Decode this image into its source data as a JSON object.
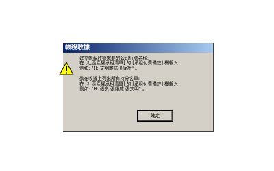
{
  "dialog": {
    "title": "帳稅收據",
    "icon": "warning-icon",
    "message_lines_1": [
      "建立帳稅收據需要的公司行號名稱:",
      "在 [社區產權承租清單] 的 [承租付費備註] 欄輸入",
      "例如: \"H: 文明雜誌出版社\" 。"
    ],
    "message_lines_2": [
      "欲在收據上列出所有持分名單:",
      "在 [社區產權承租清單] 的 [承租付費備註] 欄輸入",
      "例如: \"H: 張良 張耀威 張文明\" 。"
    ],
    "ok_label": "確定"
  },
  "colors": {
    "dialog_bg": "#d4d0c8",
    "titlebar_start": "#0a246a",
    "titlebar_end": "#a6caf0",
    "warning_yellow": "#ffff00"
  }
}
